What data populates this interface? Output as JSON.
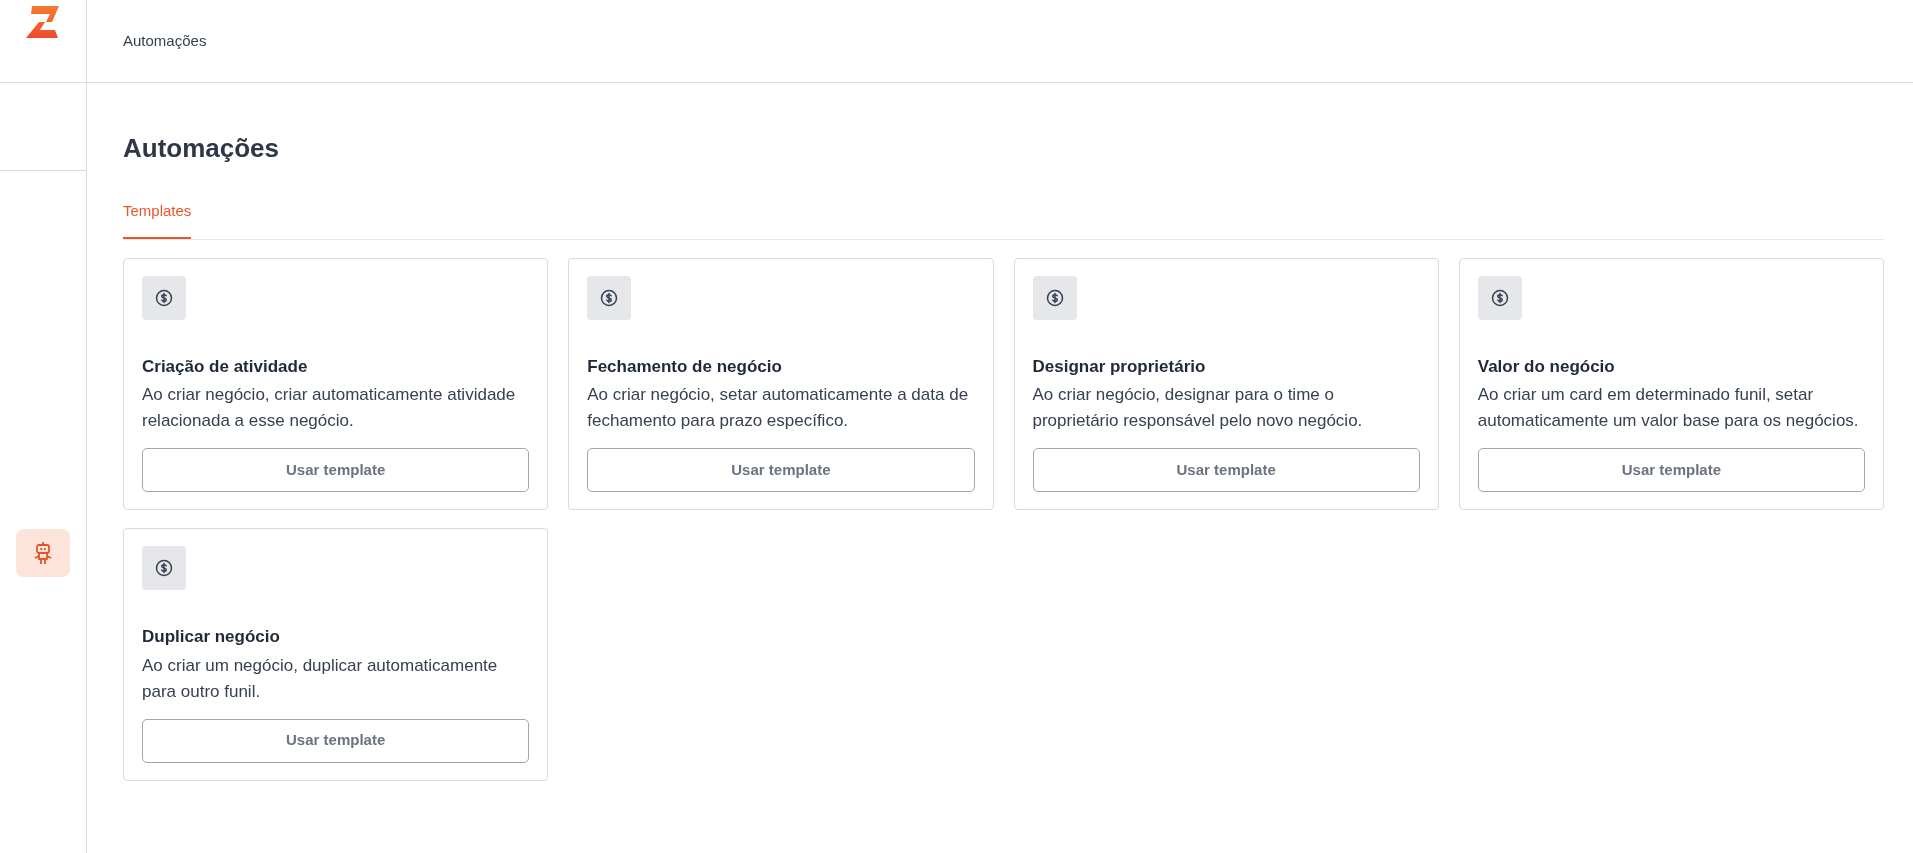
{
  "header": {
    "breadcrumb": "Automações"
  },
  "sidebar": {
    "items": [
      {
        "kind": "automations",
        "selected": true
      }
    ]
  },
  "page": {
    "title": "Automações"
  },
  "tabs": [
    {
      "label": "Templates",
      "selected": true
    }
  ],
  "templates": [
    {
      "title": "Criação de atividade",
      "description": "Ao criar negócio, criar automaticamente atividade relacionada a esse negócio.",
      "button": "Usar template"
    },
    {
      "title": "Fechamento de negócio",
      "description": "Ao criar negócio, setar automaticamente a data de fechamento para prazo específico.",
      "button": "Usar template"
    },
    {
      "title": "Designar proprietário",
      "description": "Ao criar negócio, designar para o time o proprietário responsável pelo novo negócio.",
      "button": "Usar template"
    },
    {
      "title": "Valor do negócio",
      "description": "Ao criar um card em determinado funil, setar automaticamente um valor base para os negócios.",
      "button": "Usar template"
    },
    {
      "title": "Duplicar negócio",
      "description": "Ao criar um negócio, duplicar automaticamente para outro funil.",
      "button": "Usar template"
    }
  ]
}
